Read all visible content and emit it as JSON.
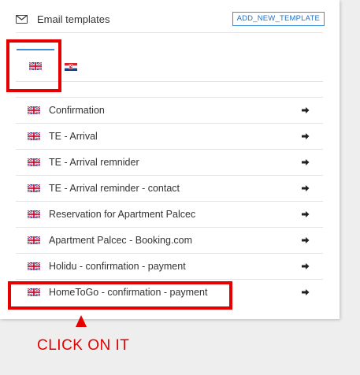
{
  "header": {
    "icon": "envelope-icon",
    "title": "Email templates",
    "add_button": "ADD_NEW_TEMPLATE"
  },
  "languages": {
    "active": "english-flag-icon",
    "inactive": "croatian-flag-icon"
  },
  "templates": [
    {
      "label": "Confirmation"
    },
    {
      "label": "TE - Arrival"
    },
    {
      "label": "TE - Arrival remnider"
    },
    {
      "label": "TE - Arrival reminder - contact"
    },
    {
      "label": "Reservation for Apartment Palcec"
    },
    {
      "label": "Apartment Palcec - Booking.com"
    },
    {
      "label": "Holidu - confirmation - payment"
    },
    {
      "label": "HomeToGo - confirmation - payment"
    }
  ],
  "annotation": {
    "text": "CLICK ON IT"
  },
  "colors": {
    "accent": "#1e73c8",
    "highlight": "#e60000"
  }
}
